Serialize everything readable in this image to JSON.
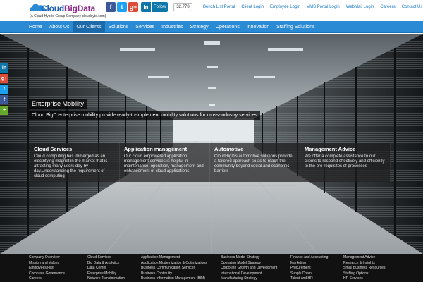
{
  "header": {
    "logo_text_a": "Cloud",
    "logo_text_b": "BigData",
    "logo_tagline": "(A Cloud Hybrid Group Company cloudbyte.com)",
    "social": {
      "facebook": "f",
      "twitter": "t",
      "google": "g+",
      "linkedin": "in",
      "follow_label": "Follow",
      "follower_count": "32,778"
    },
    "top_links": [
      "Bench List Portal",
      "Client Login",
      "Employee Login",
      "VMS Portal Login",
      "WebMail Login",
      "Careers",
      "Contact Us"
    ]
  },
  "nav": {
    "items": [
      "Home",
      "About Us",
      "Our Clients",
      "Solutions",
      "Services",
      "Industries",
      "Strategy",
      "Operations",
      "Innovation",
      "Staffing Solutions"
    ],
    "active_index": 2
  },
  "hero": {
    "title": "Enterprise Mobility",
    "description": "Cloud BigD enterprise mobility provide ready-to-implement mobility solutions for cross-industry services"
  },
  "left_share": [
    "in",
    "g+",
    "t",
    "f",
    "+"
  ],
  "panels": [
    {
      "title": "Cloud Services",
      "text": "Cloud computing has immerged as an electrifying magnet in the market that is attracting many users day-by-day.Understanding the requirement of cloud computing"
    },
    {
      "title": "Application management",
      "text": "Our cloud empowered application management services is helpful in maintenance, operation, management and enhancement of cloud applications"
    },
    {
      "title": "Automotive",
      "text": "CloudBigD's automotive solutions provide a tailored approach so as to reach the community beyond social and economic barriers"
    },
    {
      "title": "Management Advice",
      "text": "We offer a complete assistance to our clients to respond effectively and efficiently to the pre-requisites of processes"
    }
  ],
  "footer": {
    "col1": [
      "Company Overview",
      "Mission and Values",
      "Employees First",
      "Corporate Governance",
      "Careers"
    ],
    "col2": [
      "Cloud Services",
      "Big Data & Analytics",
      "Data Center",
      "Enterprise Mobility",
      "Network Transformation"
    ],
    "col3": [
      "Application Management",
      "Application Modernization & Optimizations",
      "Business Communication Services",
      "Business Continuity",
      "Business Information Management (BIM)"
    ],
    "col4": [
      "Business Model Strategy",
      "Operating Model Strategy",
      "Corporate Growth and Development",
      "International Development",
      "Manufacturing Strategy"
    ],
    "col5": [
      "Finance and Accounting",
      "Marketing",
      "Procurement",
      "Supply Chain",
      "Talent and HR"
    ],
    "col6": [
      "Management Advice",
      "Research & Insights",
      "Small Business Resources",
      "Staffing Options",
      "HR Services"
    ]
  },
  "colors": {
    "nav_bg": "#2a8ad4",
    "nav_active": "#1c6aaa",
    "link": "#1a78c2",
    "footer_bg": "#111111"
  }
}
